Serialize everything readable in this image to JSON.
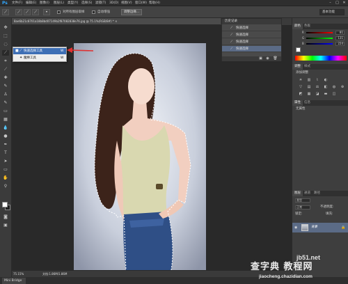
{
  "app": {
    "logo": "Ps"
  },
  "menu": [
    "文件(F)",
    "编辑(E)",
    "图像(I)",
    "图层(L)",
    "类型(Y)",
    "选择(S)",
    "滤镜(T)",
    "3D(D)",
    "视图(V)",
    "窗口(W)",
    "帮助(H)"
  ],
  "window_controls": {
    "minimize": "–",
    "maximize": "□",
    "close": "✕"
  },
  "options_bar": {
    "sample_all_label": "对所有图层取样",
    "auto_enhance_label": "自动增强",
    "refine_edge_label": "调整边缘...",
    "workspace_value": "基本功能"
  },
  "document": {
    "tab_title": "8ae6b21c8701a18b8bd07149b2f87082838e76.jpg @ 75.1%(RGB/8#) * ×",
    "zoom": "75.15%",
    "info": "文档:1.86M/1.86M"
  },
  "context_menu": {
    "items": [
      {
        "label": "快速选择工具",
        "key": "W",
        "selected": true
      },
      {
        "label": "魔棒工具",
        "key": "W",
        "selected": false
      }
    ]
  },
  "history": {
    "title": "历史记录",
    "items": [
      "快速选择",
      "快速选择",
      "快速选择",
      "快速选择"
    ]
  },
  "panels": {
    "color_tabs": [
      "颜色",
      "色板"
    ],
    "color_values": {
      "r": "81",
      "g": "131",
      "b": "224"
    },
    "adjust_tabs": [
      "调整",
      "样式"
    ],
    "adjust_title": "添加调整",
    "properties_tabs": [
      "属性",
      "信息"
    ],
    "properties_body": "无属性",
    "layer_tabs": [
      "图层",
      "通道",
      "路径"
    ],
    "layer_kind": "类型",
    "layer_mode": "正常",
    "opacity_label": "不透明度:",
    "lock_label": "锁定:",
    "fill_label": "填充:",
    "background_layer_name": "背景"
  },
  "minibridge": "Mini Bridge",
  "watermark": {
    "site": "jb51.net",
    "title": "查字典 教程网",
    "url": "jiaocheng.chazidian.com"
  },
  "colors": {
    "selection_highlight": "#3e6fb5",
    "history_active": "#5b6b86",
    "arrow": "#e03030"
  }
}
